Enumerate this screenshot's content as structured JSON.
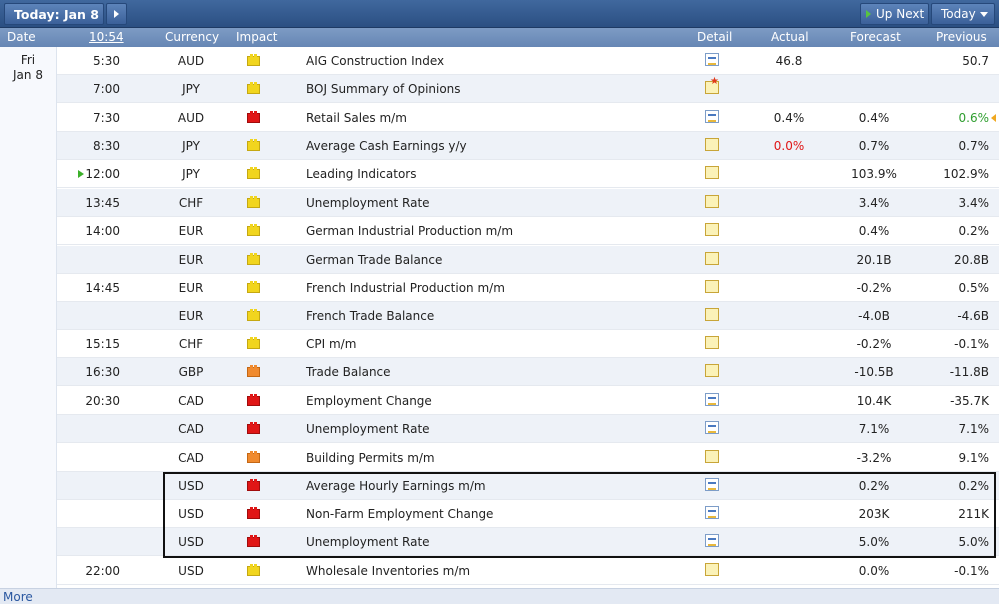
{
  "toolbar": {
    "today_label": "Today: Jan 8",
    "up_next_label": "Up Next",
    "today_dropdown_label": "Today"
  },
  "columns": {
    "date": "Date",
    "time": "10:54",
    "currency": "Currency",
    "impact": "Impact",
    "detail": "Detail",
    "actual": "Actual",
    "forecast": "Forecast",
    "previous": "Previous"
  },
  "day": {
    "weekday": "Fri",
    "date": "Jan 8"
  },
  "events": [
    {
      "time": "5:30",
      "currency": "AUD",
      "impact": "yellow",
      "event": "AIG Construction Index",
      "detail": "graph",
      "actual": "46.8",
      "forecast": "",
      "previous": "50.7"
    },
    {
      "time": "7:00",
      "currency": "JPY",
      "impact": "yellow",
      "event": "BOJ Summary of Opinions",
      "detail": "star",
      "actual": "",
      "forecast": "",
      "previous": ""
    },
    {
      "time": "7:30",
      "currency": "AUD",
      "impact": "red",
      "event": "Retail Sales m/m",
      "detail": "graph",
      "actual": "0.4%",
      "forecast": "0.4%",
      "previous": "0.6%"
    },
    {
      "time": "8:30",
      "currency": "JPY",
      "impact": "yellow",
      "event": "Average Cash Earnings y/y",
      "detail": "folder",
      "actual": "0.0%",
      "forecast": "0.7%",
      "previous": "0.7%"
    },
    {
      "time": "12:00",
      "currency": "JPY",
      "impact": "yellow",
      "event": "Leading Indicators",
      "detail": "folder",
      "actual": "",
      "forecast": "103.9%",
      "previous": "102.9%"
    },
    {
      "time": "13:45",
      "currency": "CHF",
      "impact": "yellow",
      "event": "Unemployment Rate",
      "detail": "folder",
      "actual": "",
      "forecast": "3.4%",
      "previous": "3.4%"
    },
    {
      "time": "14:00",
      "currency": "EUR",
      "impact": "yellow",
      "event": "German Industrial Production m/m",
      "detail": "folder",
      "actual": "",
      "forecast": "0.4%",
      "previous": "0.2%"
    },
    {
      "time": "",
      "currency": "EUR",
      "impact": "yellow",
      "event": "German Trade Balance",
      "detail": "folder",
      "actual": "",
      "forecast": "20.1B",
      "previous": "20.8B"
    },
    {
      "time": "14:45",
      "currency": "EUR",
      "impact": "yellow",
      "event": "French Industrial Production m/m",
      "detail": "folder",
      "actual": "",
      "forecast": "-0.2%",
      "previous": "0.5%"
    },
    {
      "time": "",
      "currency": "EUR",
      "impact": "yellow",
      "event": "French Trade Balance",
      "detail": "folder",
      "actual": "",
      "forecast": "-4.0B",
      "previous": "-4.6B"
    },
    {
      "time": "15:15",
      "currency": "CHF",
      "impact": "yellow",
      "event": "CPI m/m",
      "detail": "folder",
      "actual": "",
      "forecast": "-0.2%",
      "previous": "-0.1%"
    },
    {
      "time": "16:30",
      "currency": "GBP",
      "impact": "orange",
      "event": "Trade Balance",
      "detail": "folder",
      "actual": "",
      "forecast": "-10.5B",
      "previous": "-11.8B"
    },
    {
      "time": "20:30",
      "currency": "CAD",
      "impact": "red",
      "event": "Employment Change",
      "detail": "graph",
      "actual": "",
      "forecast": "10.4K",
      "previous": "-35.7K"
    },
    {
      "time": "",
      "currency": "CAD",
      "impact": "red",
      "event": "Unemployment Rate",
      "detail": "graph",
      "actual": "",
      "forecast": "7.1%",
      "previous": "7.1%"
    },
    {
      "time": "",
      "currency": "CAD",
      "impact": "orange",
      "event": "Building Permits m/m",
      "detail": "folder",
      "actual": "",
      "forecast": "-3.2%",
      "previous": "9.1%"
    },
    {
      "time": "",
      "currency": "USD",
      "impact": "red",
      "event": "Average Hourly Earnings m/m",
      "detail": "graph",
      "actual": "",
      "forecast": "0.2%",
      "previous": "0.2%"
    },
    {
      "time": "",
      "currency": "USD",
      "impact": "red",
      "event": "Non-Farm Employment Change",
      "detail": "graph",
      "actual": "",
      "forecast": "203K",
      "previous": "211K"
    },
    {
      "time": "",
      "currency": "USD",
      "impact": "red",
      "event": "Unemployment Rate",
      "detail": "graph",
      "actual": "",
      "forecast": "5.0%",
      "previous": "5.0%"
    },
    {
      "time": "22:00",
      "currency": "USD",
      "impact": "yellow",
      "event": "Wholesale Inventories m/m",
      "detail": "folder",
      "actual": "",
      "forecast": "0.0%",
      "previous": "-0.1%"
    }
  ],
  "footer": {
    "more_label": "More"
  },
  "colors": {
    "actual_better": "#2f9e2f",
    "actual_worse": "#e01616",
    "impact_high": "#e01616",
    "impact_medium": "#f08a2e",
    "impact_low": "#f1d51e"
  }
}
